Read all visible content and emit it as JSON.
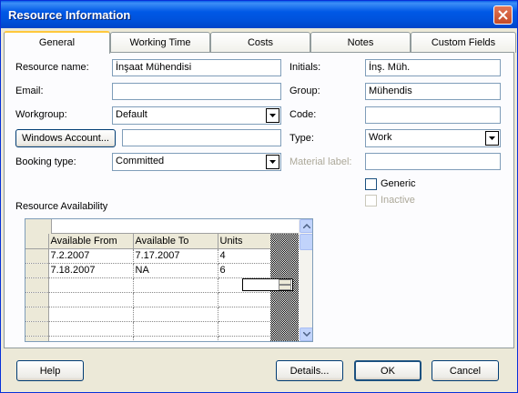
{
  "window": {
    "title": "Resource Information"
  },
  "tabs": [
    "General",
    "Working Time",
    "Costs",
    "Notes",
    "Custom Fields"
  ],
  "form": {
    "resource_name_label": "Resource name:",
    "resource_name_value": "İnşaat Mühendisi",
    "email_label": "Email:",
    "email_value": "",
    "workgroup_label": "Workgroup:",
    "workgroup_value": "Default",
    "windows_account_button": "Windows Account...",
    "windows_account_value": "",
    "booking_type_label": "Booking type:",
    "booking_type_value": "Committed",
    "initials_label": "Initials:",
    "initials_value": "İnş. Müh.",
    "group_label": "Group:",
    "group_value": "Mühendis",
    "code_label": "Code:",
    "code_value": "",
    "type_label": "Type:",
    "type_value": "Work",
    "material_label_label": "Material label:",
    "material_label_value": "",
    "generic_label": "Generic",
    "generic_checked": false,
    "inactive_label": "Inactive",
    "inactive_checked": false
  },
  "availability": {
    "title": "Resource Availability",
    "columns": [
      "Available From",
      "Available To",
      "Units"
    ],
    "rows": [
      [
        "7.2.2007",
        "7.17.2007",
        "4"
      ],
      [
        "7.18.2007",
        "NA",
        "6"
      ],
      [
        "",
        "",
        ""
      ],
      [
        "",
        "",
        ""
      ],
      [
        "",
        "",
        ""
      ],
      [
        "",
        "",
        ""
      ],
      [
        "",
        "",
        ""
      ]
    ]
  },
  "footer": {
    "help": "Help",
    "details": "Details...",
    "ok": "OK",
    "cancel": "Cancel"
  }
}
